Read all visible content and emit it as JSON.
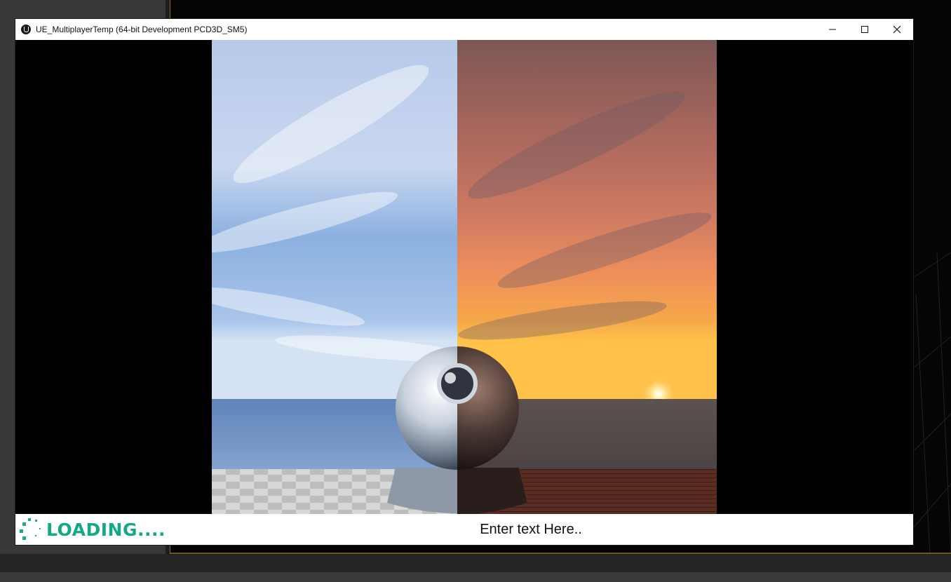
{
  "window": {
    "title": "UE_MultiplayerTemp (64-bit Development PCD3D_SM5)",
    "controls": {
      "minimize": "minimize-icon",
      "maximize": "maximize-icon",
      "close": "close-icon"
    }
  },
  "hud": {
    "loading_label": "LOADING....",
    "text_input_placeholder": "Enter text Here..",
    "accent_color": "#14a986"
  },
  "scene": {
    "left_sky": "#a9c4ec",
    "right_sky": "#b06a5e",
    "sun_color": "#ffd27a"
  }
}
